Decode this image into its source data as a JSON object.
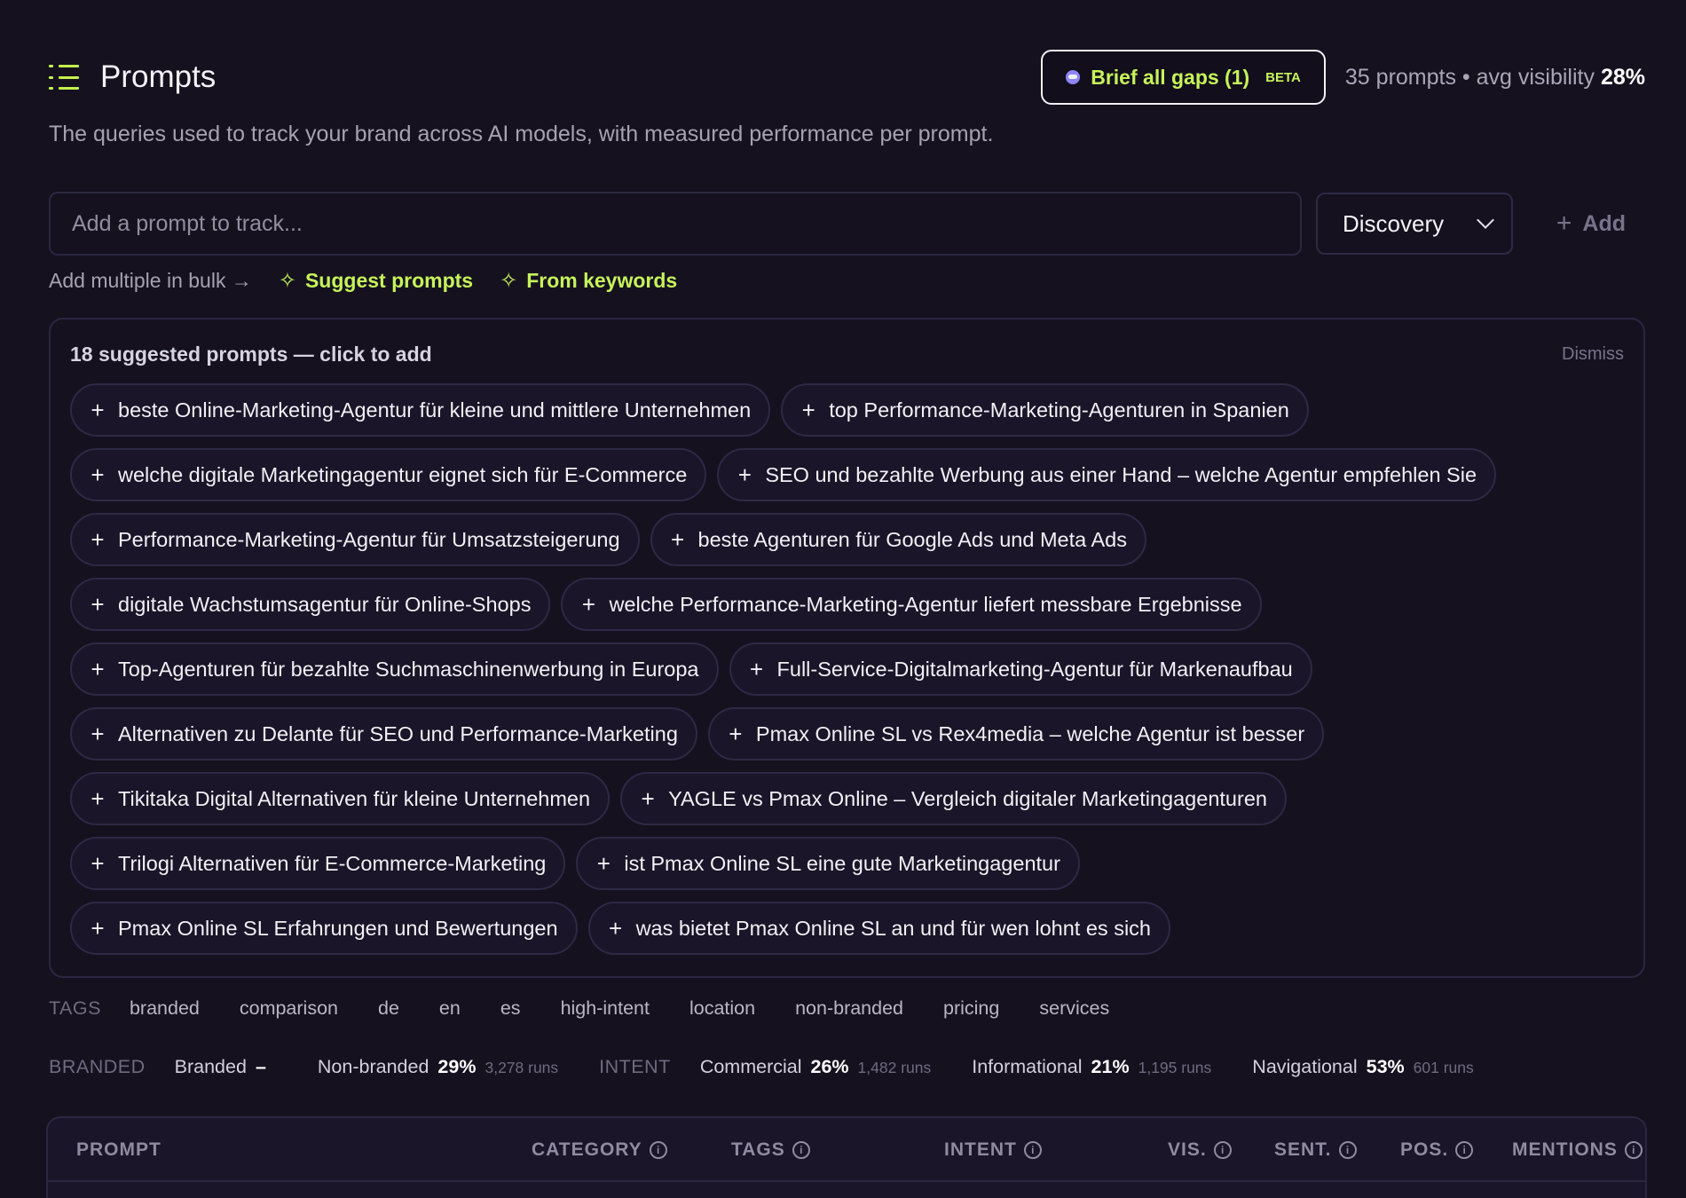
{
  "header": {
    "title": "Prompts",
    "brief_button_label": "Brief all gaps (1)",
    "brief_badge": "BETA",
    "summary_prefix": "35 prompts • avg visibility",
    "summary_value": "28%"
  },
  "subtitle": "The queries used to track your brand across AI models, with measured performance per prompt.",
  "input": {
    "placeholder": "Add a prompt to track...",
    "category_value": "Discovery",
    "add_label": "Add"
  },
  "links": {
    "bulk": "Add multiple in bulk →",
    "suggest": "Suggest prompts",
    "from_keywords": "From keywords"
  },
  "suggestions": {
    "title": "18 suggested prompts — click to add",
    "dismiss": "Dismiss",
    "rows": [
      [
        "beste Online-Marketing-Agentur für kleine und mittlere Unternehmen",
        "top Performance-Marketing-Agenturen in Spanien"
      ],
      [
        "welche digitale Marketingagentur eignet sich für E-Commerce",
        "SEO und bezahlte Werbung aus einer Hand – welche Agentur empfehlen Sie"
      ],
      [
        "Performance-Marketing-Agentur für Umsatzsteigerung",
        "beste Agenturen für Google Ads und Meta Ads"
      ],
      [
        "digitale Wachstumsagentur für Online-Shops",
        "welche Performance-Marketing-Agentur liefert messbare Ergebnisse"
      ],
      [
        "Top-Agenturen für bezahlte Suchmaschinenwerbung in Europa",
        "Full-Service-Digitalmarketing-Agentur für Markenaufbau"
      ],
      [
        "Alternativen zu Delante für SEO und Performance-Marketing",
        "Pmax Online SL vs Rex4media – welche Agentur ist besser"
      ],
      [
        "Tikitaka Digital Alternativen für kleine Unternehmen",
        "YAGLE vs Pmax Online – Vergleich digitaler Marketingagenturen"
      ],
      [
        "Trilogi Alternativen für E-Commerce-Marketing",
        "ist Pmax Online SL eine gute Marketingagentur"
      ],
      [
        "Pmax Online SL Erfahrungen und Bewertungen",
        "was bietet Pmax Online SL an und für wen lohnt es sich"
      ]
    ]
  },
  "tags": {
    "label": "TAGS",
    "items": [
      "branded",
      "comparison",
      "de",
      "en",
      "es",
      "high-intent",
      "location",
      "non-branded",
      "pricing",
      "services"
    ]
  },
  "stats": {
    "branded_label": "BRANDED",
    "branded": {
      "name": "Branded",
      "value": "–"
    },
    "non_branded": {
      "name": "Non-branded",
      "value": "29%",
      "runs": "3,278 runs"
    },
    "intent_label": "INTENT",
    "commercial": {
      "name": "Commercial",
      "value": "26%",
      "runs": "1,482 runs"
    },
    "informational": {
      "name": "Informational",
      "value": "21%",
      "runs": "1,195 runs"
    },
    "navigational": {
      "name": "Navigational",
      "value": "53%",
      "runs": "601 runs"
    }
  },
  "table": {
    "columns": [
      "PROMPT",
      "CATEGORY",
      "TAGS",
      "INTENT",
      "VIS.",
      "SENT.",
      "POS.",
      "MENTIONS"
    ]
  },
  "colors": {
    "background": "#15111f",
    "accent": "#c6f35a",
    "border": "#2c2740"
  }
}
